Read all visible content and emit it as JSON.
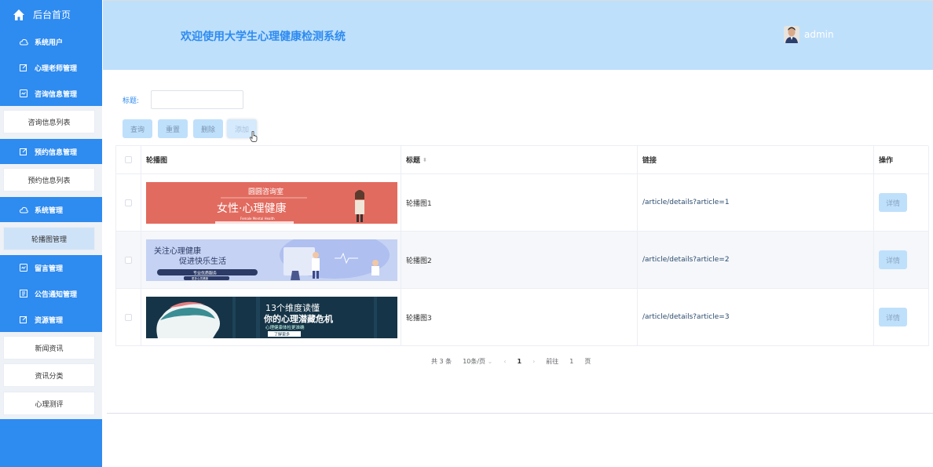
{
  "sidebar": {
    "home_label": "后台首页",
    "items": [
      {
        "label": "系统用户",
        "icon": "cloud-icon"
      },
      {
        "label": "心理老师管理",
        "icon": "edit-icon"
      },
      {
        "label": "咨询信息管理",
        "icon": "chat-icon"
      },
      {
        "label": "预约信息管理",
        "icon": "edit-icon"
      },
      {
        "label": "系统管理",
        "icon": "cloud-icon"
      },
      {
        "label": "留言管理",
        "icon": "chat-icon"
      },
      {
        "label": "公告通知管理",
        "icon": "document-icon"
      },
      {
        "label": "资源管理",
        "icon": "edit-icon"
      }
    ],
    "subitems": {
      "consult_list": "咨询信息列表",
      "appointment_list": "预约信息列表",
      "carousel": "轮播图管理",
      "news": "新闻资讯",
      "news_category": "资讯分类",
      "assessment": "心理测评"
    }
  },
  "header": {
    "title": "欢迎使用大学生心理健康检测系统",
    "username": "admin"
  },
  "search": {
    "label": "标题:",
    "value": "",
    "placeholder": ""
  },
  "toolbar": {
    "query": "查询",
    "reset": "重置",
    "delete": "删除",
    "add": "添加"
  },
  "table": {
    "columns": {
      "image": "轮播图",
      "title": "标题",
      "link": "链接",
      "operation": "操作"
    },
    "rows": [
      {
        "title": "轮播图1",
        "link": "/article/details?article=1",
        "action": "详情",
        "banner": {
          "top_text": "圆圆咨询室",
          "main_text": "女性·心理健康",
          "sub_text": "Female Mental Health",
          "bg": "#e26b5f"
        }
      },
      {
        "title": "轮播图2",
        "link": "/article/details?article=2",
        "action": "详情",
        "banner": {
          "line1": "关注心理健康",
          "line2": "促进快乐生活",
          "tag1": "专业优质服务",
          "tag2": "更多心灵健康",
          "bg": "#c5d2f3"
        }
      },
      {
        "title": "轮播图3",
        "link": "/article/details?article=3",
        "action": "详情",
        "banner": {
          "line1": "13个维度读懂",
          "line2": "你的心理潜藏危机",
          "line3": "心理健康体检更准确",
          "btn": "了解更多",
          "bg": "#163447"
        }
      }
    ]
  },
  "pagination": {
    "total": "共 3 条",
    "page_size": "10条/页",
    "current": "1",
    "goto_prefix": "前往",
    "goto_value": "1",
    "goto_suffix": "页"
  },
  "colors": {
    "primary": "#2e8bf0",
    "header_bg": "#bfe0fb",
    "button_bg": "#bfe0fb"
  }
}
